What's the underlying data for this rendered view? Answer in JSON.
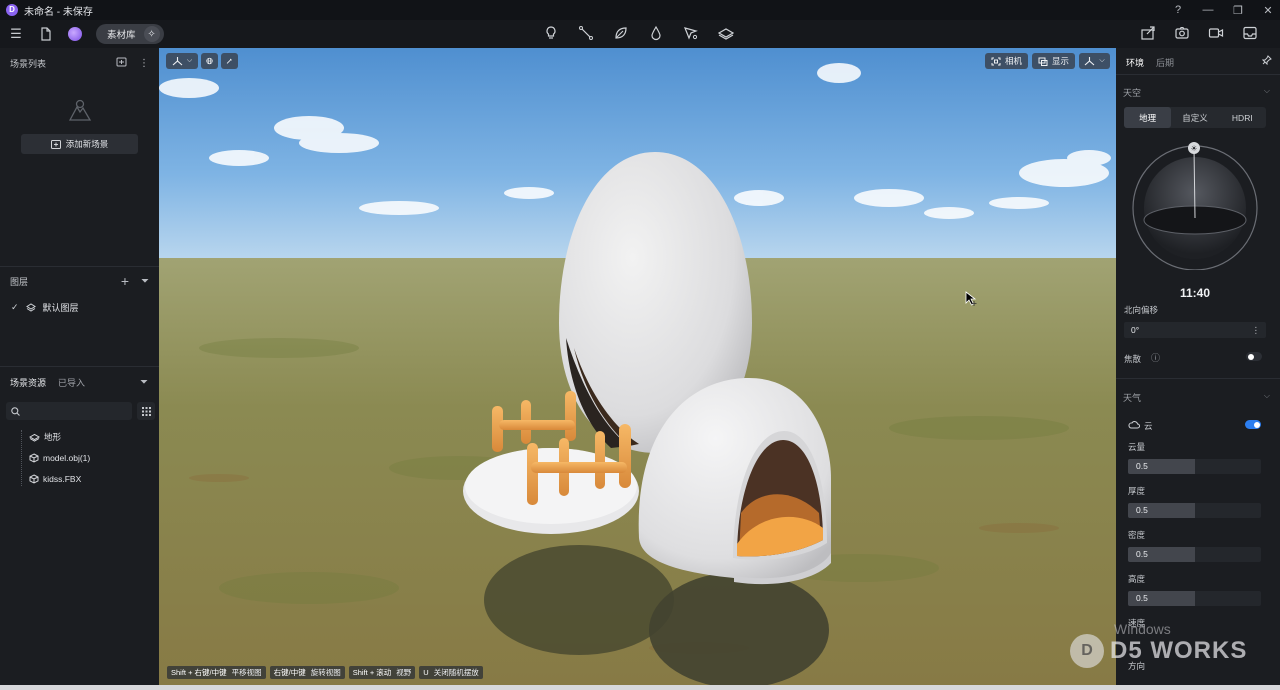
{
  "window": {
    "title": "未命名 - 未保存",
    "logo_letter": "D",
    "controls": [
      "?",
      "—",
      "❐",
      "✕"
    ]
  },
  "toolbar": {
    "library_label": "素材库",
    "center_tools": [
      "light-bulb-icon",
      "path-icon",
      "leaf-icon",
      "water-drop-icon",
      "cursor-brush-icon",
      "terrain-layers-icon"
    ],
    "right_tools": [
      "export-icon",
      "camera-icon",
      "video-icon",
      "render-icon"
    ]
  },
  "left_panel": {
    "scene_list_title": "场景列表",
    "add_scene_label": "添加新场景",
    "layers_title": "图层",
    "default_layer": "默认图层",
    "assets_tab_active": "场景资源",
    "assets_tab_inactive": "已导入",
    "search_placeholder": "",
    "assets": [
      "地形",
      "model.obj(1)",
      "kidss.FBX"
    ]
  },
  "viewport": {
    "camera_label": "相机",
    "display_label": "显示",
    "hints": [
      {
        "key": "Shift + 右键/中键",
        "action": "平移视图"
      },
      {
        "key": "右键/中键",
        "action": "旋转视图"
      },
      {
        "key": "Shift + 滚动",
        "action": "视野"
      },
      {
        "key": "U",
        "action": "关闭随机摆放"
      }
    ]
  },
  "right_panel": {
    "tab_env": "环境",
    "tab_post": "后期",
    "sky_title": "天空",
    "sky_modes": [
      "地理",
      "自定义",
      "HDRI"
    ],
    "sky_mode_selected": 0,
    "time": "11:40",
    "north_offset_label": "北向偏移",
    "north_offset_value": "0°",
    "focus_label": "焦散",
    "weather_title": "天气",
    "cloud_label": "云",
    "cloud_enabled": true,
    "sliders": [
      {
        "label": "云量",
        "value": "0.5",
        "level": 0.5
      },
      {
        "label": "厚度",
        "value": "0.5",
        "level": 0.5
      },
      {
        "label": "密度",
        "value": "0.5",
        "level": 0.5
      },
      {
        "label": "高度",
        "value": "0.5",
        "level": 0.5
      }
    ],
    "speed_label": "速度",
    "direction_label": "方向"
  },
  "watermark": {
    "windows_text": "Windows",
    "brand_text": "D5 WORKS",
    "brand_letter": "D"
  },
  "colors": {
    "accent": "#2c7ef0",
    "panel": "#1b1d21",
    "sky_top": "#4f8fd0",
    "ground": "#8b8a52"
  }
}
